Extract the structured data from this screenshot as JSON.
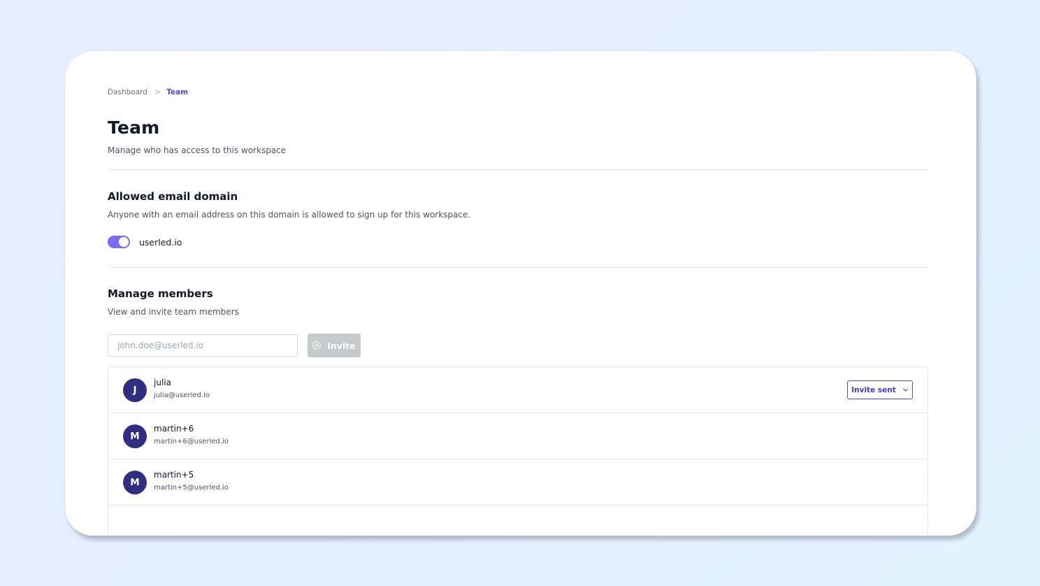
{
  "breadcrumb": {
    "items": [
      "Dashboard",
      "Team"
    ],
    "separator": ">"
  },
  "page": {
    "title": "Team",
    "subtitle": "Manage who has access to this workspace"
  },
  "email_domain_section": {
    "title": "Allowed email domain",
    "description": "Anyone with an email address on this domain is allowed to sign up for this workspace.",
    "toggle_enabled": true,
    "domain": "userled.io"
  },
  "members_section": {
    "title": "Manage members",
    "description": "View and invite team members",
    "invite_input": {
      "value": "",
      "placeholder": "john.doe@userled.io"
    },
    "invite_button_label": "Invite",
    "members": [
      {
        "initial": "J",
        "name": "julia",
        "email": "julia@userled.io",
        "status": "Invite sent"
      },
      {
        "initial": "M",
        "name": "martin+6",
        "email": "martin+6@userled.io",
        "status": ""
      },
      {
        "initial": "M",
        "name": "martin+5",
        "email": "martin+5@userled.io",
        "status": ""
      }
    ]
  },
  "colors": {
    "accent": "#4f46e5",
    "toggle": "#7c6cf0",
    "avatar": "#312e81",
    "disabled_button": "#c7c9cd"
  },
  "icons": {
    "breadcrumb_separator": "chevron-right-icon",
    "invite": "plus-circle-icon",
    "status_dropdown": "chevron-down-icon"
  }
}
